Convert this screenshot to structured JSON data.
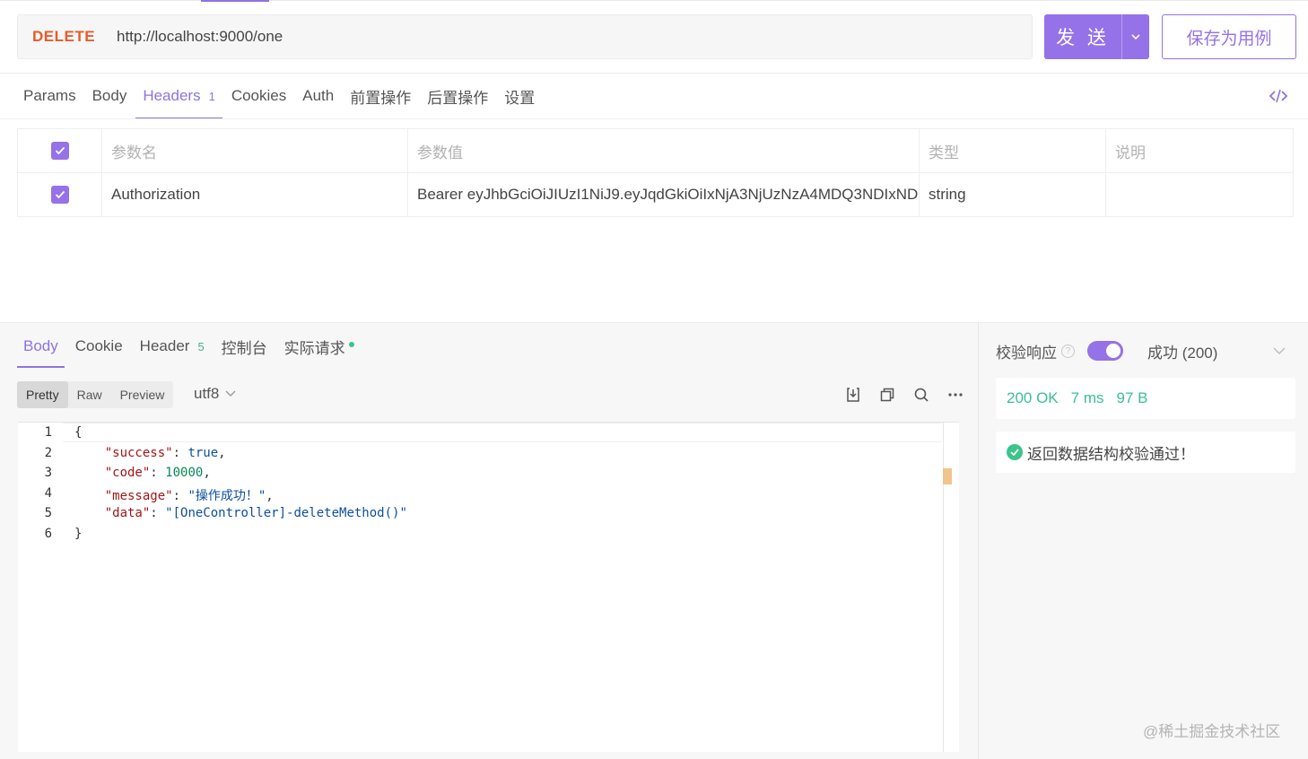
{
  "request": {
    "method": "DELETE",
    "url": "http://localhost:9000/one",
    "send_label": "发 送",
    "save_label": "保存为用例"
  },
  "request_tabs": [
    {
      "label": "Params",
      "count": null
    },
    {
      "label": "Body",
      "count": null
    },
    {
      "label": "Headers",
      "count": "1",
      "active": true
    },
    {
      "label": "Cookies",
      "count": null
    },
    {
      "label": "Auth",
      "count": null
    },
    {
      "label": "前置操作",
      "count": null
    },
    {
      "label": "后置操作",
      "count": null
    },
    {
      "label": "设置",
      "count": null
    }
  ],
  "headers_table": {
    "columns": [
      "参数名",
      "参数值",
      "类型",
      "说明"
    ],
    "rows": [
      {
        "checked": true,
        "name": "Authorization",
        "value": "Bearer eyJhbGciOiJIUzI1NiJ9.eyJqdGkiOiIxNjA3NjUzNzA4MDQ3NDIxND",
        "type": "string",
        "description": ""
      }
    ]
  },
  "response_tabs": [
    {
      "label": "Body",
      "active": true
    },
    {
      "label": "Cookie"
    },
    {
      "label": "Header",
      "count": "5"
    },
    {
      "label": "控制台"
    },
    {
      "label": "实际请求",
      "dot": true
    }
  ],
  "view_modes": [
    "Pretty",
    "Raw",
    "Preview"
  ],
  "active_view_mode": "Pretty",
  "encoding": "utf8",
  "response_body": {
    "line_numbers": [
      "1",
      "2",
      "3",
      "4",
      "5",
      "6"
    ],
    "lines": [
      "{",
      "    \"success\": true,",
      "    \"code\": 10000,",
      "    \"message\": \"操作成功！\",",
      "    \"data\": \"[OneController]-deleteMethod()\"",
      "}"
    ]
  },
  "validation": {
    "label": "校验响应",
    "enabled": true,
    "case": "成功 (200)",
    "status": "200 OK",
    "time": "7 ms",
    "size": "97 B",
    "result": "返回数据结构校验通过！"
  },
  "colors": {
    "accent": "#9572e8",
    "method": "#e85a2a",
    "success": "#3cc48a"
  },
  "watermark": "@稀土掘金技术社区"
}
